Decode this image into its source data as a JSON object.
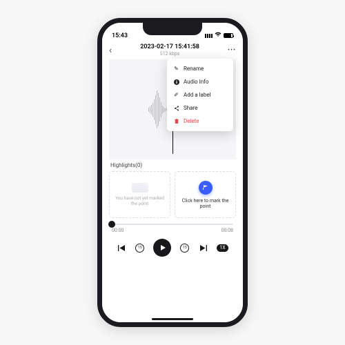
{
  "status": {
    "time": "15:43"
  },
  "header": {
    "title": "2023-02-17 15:41:58",
    "subtitle": "512 kbps"
  },
  "menu": {
    "rename": "Rename",
    "audio_info": "Audio Info",
    "add_label": "Add a label",
    "share": "Share",
    "delete": "Delete"
  },
  "highlights_label": "Highlights(0)",
  "cards": {
    "empty_hint": "You have not yet marked the point",
    "mark_hint": "Click here to mark the point"
  },
  "time": {
    "current": "00:00",
    "total": "00:08"
  },
  "controls": {
    "speed": "1X",
    "skip_back": "15",
    "skip_fwd": "15"
  }
}
